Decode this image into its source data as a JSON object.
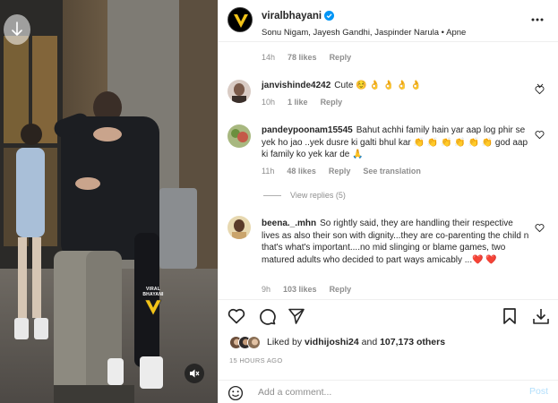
{
  "media": {
    "watermark_text": "VIRAL BHAYANI",
    "download_icon": "arrow-down-icon",
    "mute_icon": "speaker-muted-icon"
  },
  "post": {
    "username": "viralbhayani",
    "audio_line": "Sonu Nigam, Jayesh Gandhi, Jaspinder Narula • Apne",
    "more_icon": "ellipsis-icon",
    "verified_color": "#0095f6"
  },
  "top_meta": {
    "time": "14h",
    "likes": "78 likes",
    "reply": "Reply"
  },
  "comments": [
    {
      "username": "janvishinde4242",
      "text": "Cute ☺️ 👌 👌 👌 👌",
      "time": "10h",
      "likes": "1 like",
      "reply": "Reply",
      "translation": ""
    },
    {
      "username": "pandeypoonam15545",
      "text": "Bahut achhi family hain yar aap log phir se yek ho jao ..yek dusre ki galti bhul kar 👏 👏 👏 👏 👏 👏 god aap ki family ko yek kar de 🙏",
      "time": "11h",
      "likes": "48 likes",
      "reply": "Reply",
      "translation": "See translation"
    },
    {
      "username": "beena._.mhn",
      "text": "So rightly said, they are handling their respective lives as also their son with dignity...they are co-parenting the child n that's what's important....no mid slinging or blame games, two matured adults who decided to part ways amicably ...❤️ ❤️",
      "time": "9h",
      "likes": "103 likes",
      "reply": "Reply",
      "translation": ""
    }
  ],
  "view_replies": "View replies (5)",
  "actions": {
    "like_icon": "heart-icon",
    "comment_icon": "comment-bubble-icon",
    "share_icon": "paper-plane-icon",
    "save_icon": "bookmark-icon",
    "download_icon": "download-icon"
  },
  "likes": {
    "prefix": "Liked by",
    "user": "vidhijoshi24",
    "middle": "and",
    "count": "107,173 others"
  },
  "timestamp": "15 HOURS AGO",
  "add_comment": {
    "placeholder": "Add a comment...",
    "post_label": "Post",
    "emoji_icon": "smiley-icon",
    "post_color": "#b2dffc"
  }
}
